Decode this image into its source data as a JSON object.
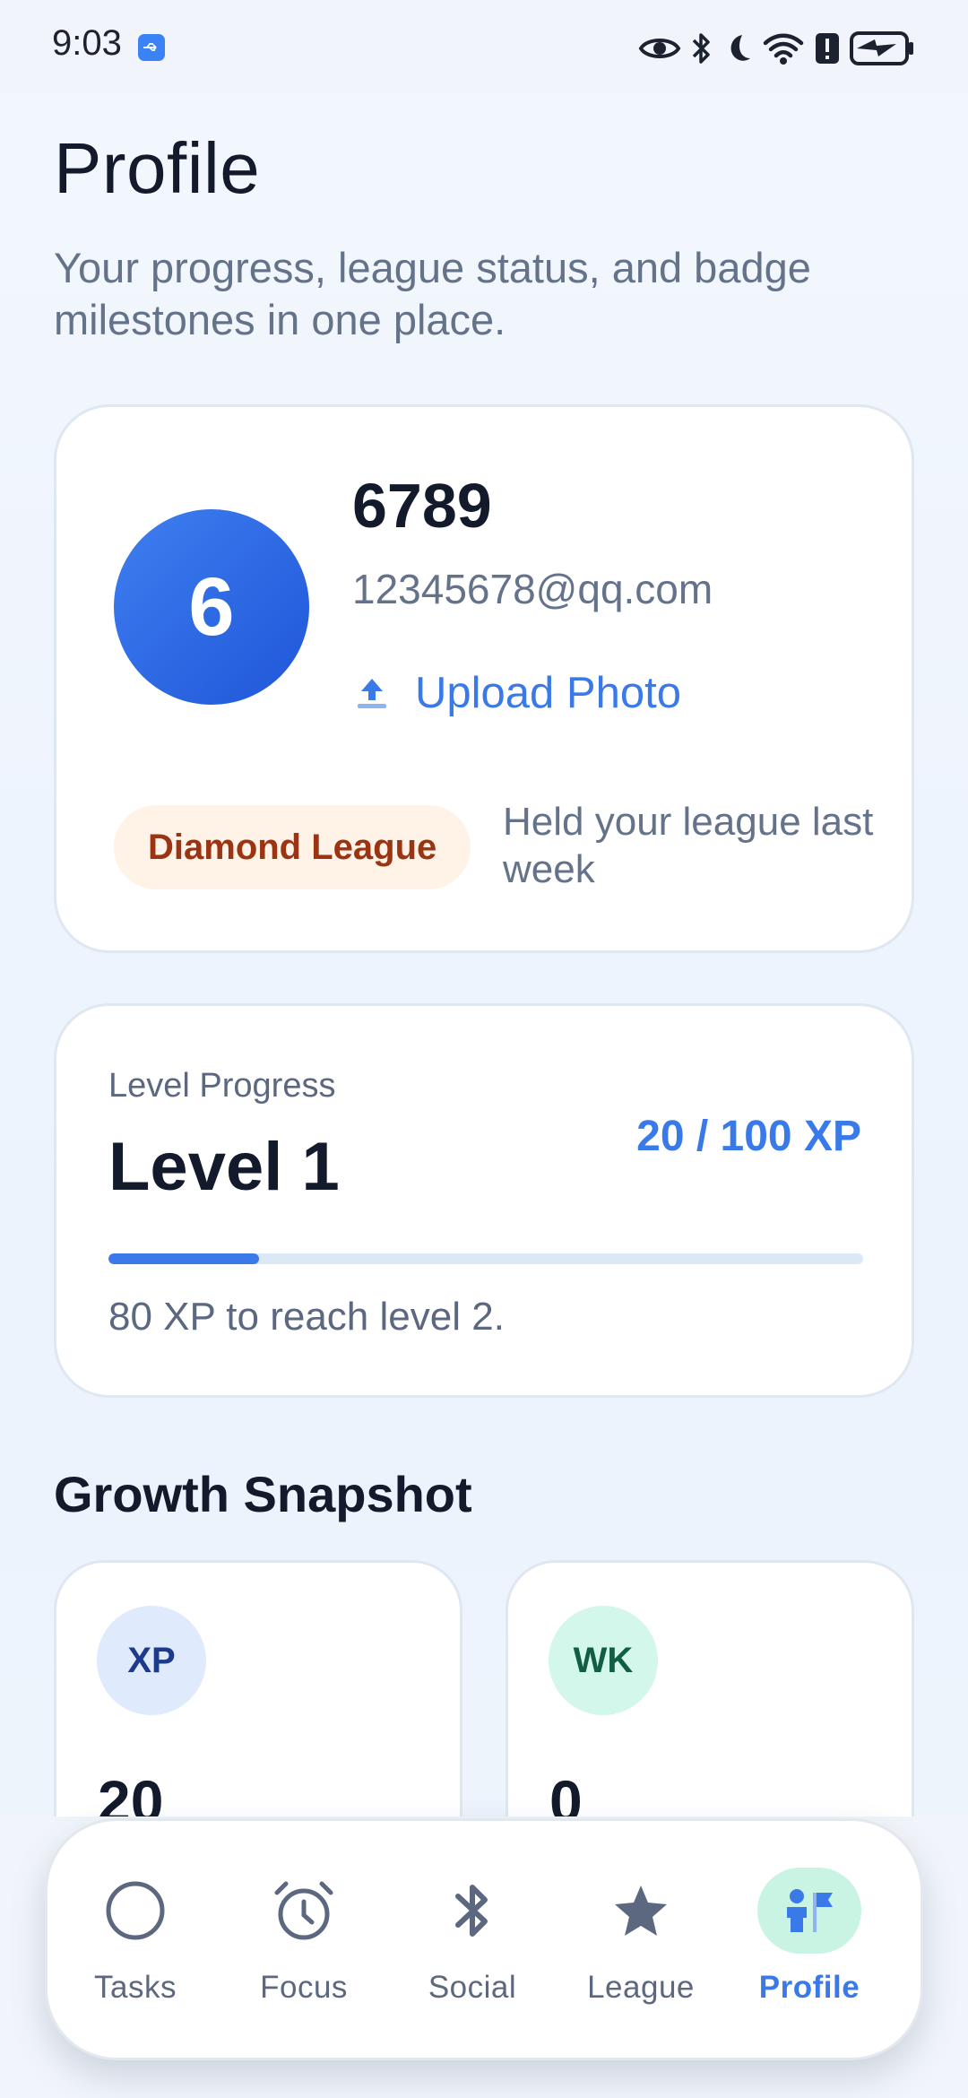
{
  "status_bar": {
    "time": "9:03",
    "icons": [
      "usb-icon",
      "eye-icon",
      "bluetooth-icon",
      "moon-icon",
      "wifi-icon",
      "alert-icon",
      "battery-charging-icon"
    ]
  },
  "header": {
    "title": "Profile",
    "subtitle": "Your progress, league status, and badge milestones in one place."
  },
  "profile": {
    "avatar_initial": "6",
    "name": "6789",
    "email": "12345678@qq.com",
    "upload_label": "Upload Photo",
    "league_badge": "Diamond League",
    "league_note": "Held your league last week"
  },
  "level": {
    "caption": "Level Progress",
    "title": "Level 1",
    "xp_text": "20 / 100 XP",
    "progress_fraction": 0.2,
    "hint": "80 XP to reach level 2."
  },
  "growth": {
    "title": "Growth Snapshot",
    "stats": [
      {
        "badge": "XP",
        "value": "20"
      },
      {
        "badge": "WK",
        "value": "0"
      }
    ]
  },
  "nav": {
    "items": [
      {
        "label": "Tasks",
        "icon": "circle-icon"
      },
      {
        "label": "Focus",
        "icon": "alarm-clock-icon"
      },
      {
        "label": "Social",
        "icon": "bluetooth-icon"
      },
      {
        "label": "League",
        "icon": "star-icon"
      },
      {
        "label": "Profile",
        "icon": "person-flag-icon"
      }
    ],
    "active": "Profile"
  },
  "colors": {
    "accent": "#3a7ae8",
    "avatar": "#2f6ae6",
    "league_text": "#9b3412",
    "league_bg": "#fff2e7",
    "active_nav_bg": "#c9f4e4"
  }
}
